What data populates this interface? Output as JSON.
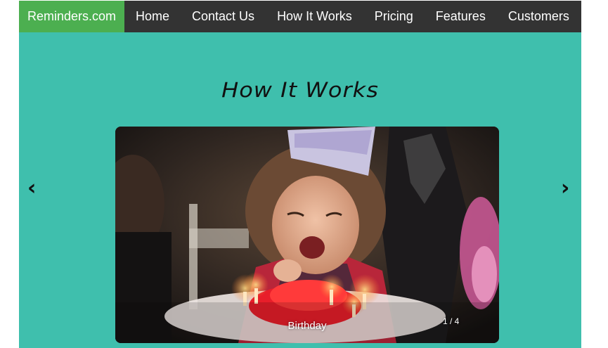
{
  "navbar": {
    "brand": "Reminders.com",
    "links": [
      "Home",
      "Contact Us",
      "How It Works",
      "Pricing",
      "Features",
      "Customers"
    ]
  },
  "section": {
    "title": "How It Works"
  },
  "carousel": {
    "prev_icon": "chevron-left",
    "next_icon": "chevron-right",
    "prev_glyph": "‹",
    "next_glyph": "›",
    "caption": "Birthday",
    "counter": "1 / 4",
    "image_subject": "child blowing out birthday cake candles"
  },
  "colors": {
    "navbar_bg": "#333333",
    "brand_bg": "#4caf50",
    "page_bg": "#3fbfad"
  }
}
